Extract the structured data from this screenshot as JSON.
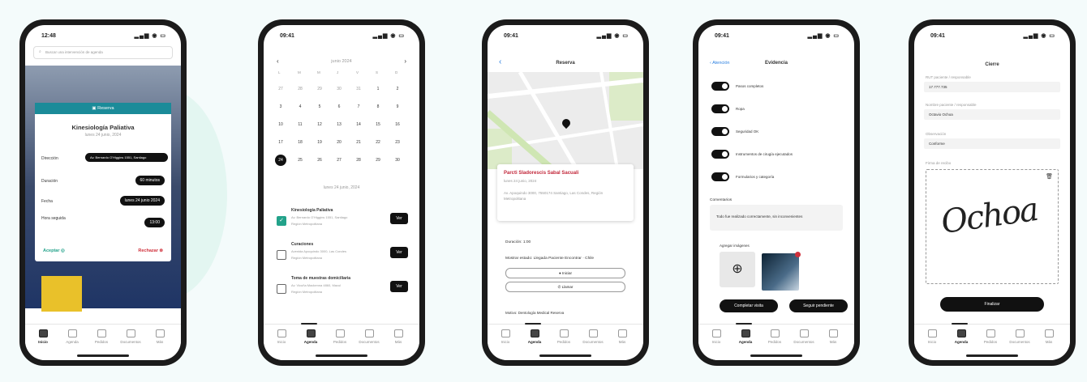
{
  "tabs": [
    "Inicio",
    "Agenda",
    "Pedidos",
    "Documentos",
    "Más"
  ],
  "phone1": {
    "time": "12:48",
    "search_placeholder": "Buscar una intervención de agenda",
    "modal": {
      "header": "Reserva",
      "title": "Kinesiología Paliativa",
      "date": "lunes 24 junio, 2024",
      "rows": [
        {
          "label": "Dirección",
          "value": "Av. Bernardo O'Higgins 1551, Santiago"
        },
        {
          "label": "Duración",
          "value": "60 minutos"
        },
        {
          "label": "Fecha",
          "value": "lunes 24 junio 2024"
        },
        {
          "label": "Hora seguida",
          "value": "13:00"
        }
      ],
      "accept": "Aceptar",
      "reject": "Rechazar"
    }
  },
  "phone2": {
    "time": "09:41",
    "month": "junio 2024",
    "weekdays": [
      "L",
      "M",
      "M",
      "J",
      "V",
      "S",
      "D"
    ],
    "weeks": [
      [
        "27",
        "28",
        "29",
        "30",
        "31",
        "1",
        "2"
      ],
      [
        "3",
        "4",
        "5",
        "6",
        "7",
        "8",
        "9"
      ],
      [
        "10",
        "11",
        "12",
        "13",
        "14",
        "15",
        "16"
      ],
      [
        "17",
        "18",
        "19",
        "20",
        "21",
        "22",
        "23"
      ],
      [
        "24",
        "25",
        "26",
        "27",
        "28",
        "29",
        "30"
      ]
    ],
    "selected_day": "24",
    "selected_label": "lunes 24 junio, 2024",
    "items": [
      {
        "title": "Kinesiología Paliativa",
        "line1": "Av. Bernardo O'Higgins 1551, Santiago",
        "line2": "Región Metropolitana",
        "checked": true,
        "button": "Ver"
      },
      {
        "title": "Curaciones",
        "line1": "Avenida Apoquindo 3000, Las Condes",
        "line2": "Región Metropolitana",
        "checked": false,
        "button": "Ver"
      },
      {
        "title": "Toma de muestras domiciliaria",
        "line1": "Av. Vicuña Mackenna 4860, Macul",
        "line2": "Región Metropolitana",
        "checked": false,
        "button": "Ver"
      }
    ]
  },
  "phone3": {
    "time": "09:41",
    "title": "Reserva",
    "card_title": "Parcti Sladorescis Sabal Sacuali",
    "card_date": "lunes 24 junio, 2024",
    "card_address": "Av. Apoquindo 3000, 7550174 Santiago, Las Condes, Región Metropolitana",
    "duration": "Duración: 1:00",
    "subtitle": "Mostrar estado: Llegada Paciente Encontrar · Chile",
    "btn1": "Iniciar",
    "btn2": "Llamar",
    "bottom": "Motivo: Dentología Medical Reserva"
  },
  "phone4": {
    "time": "09:41",
    "back": "Atención",
    "title": "Evidencia",
    "toggles": [
      "Pasos completos",
      "Ropa",
      "Seguridad OK",
      "Instrumentos de cirugía ejecutados",
      "Formularios y categoría"
    ],
    "comments_label": "Comentarios",
    "comment": "Todo fue realizado correctamente, sin inconvenientes",
    "photos_label": "Agregar imágenes",
    "btn_left": "Completar visita",
    "btn_right": "Seguir pendiente"
  },
  "phone5": {
    "time": "09:41",
    "title": "Cierre",
    "fields": [
      {
        "label": "RUT paciente / responsable",
        "value": "17.777.735"
      },
      {
        "label": "Nombre paciente / responsable",
        "value": "Octavio Ochoa"
      },
      {
        "label": "Observación",
        "value": "Conforme"
      }
    ],
    "signature_label": "Firma de recibo",
    "signature_text": "Ochoa",
    "finish": "Finalizar"
  }
}
